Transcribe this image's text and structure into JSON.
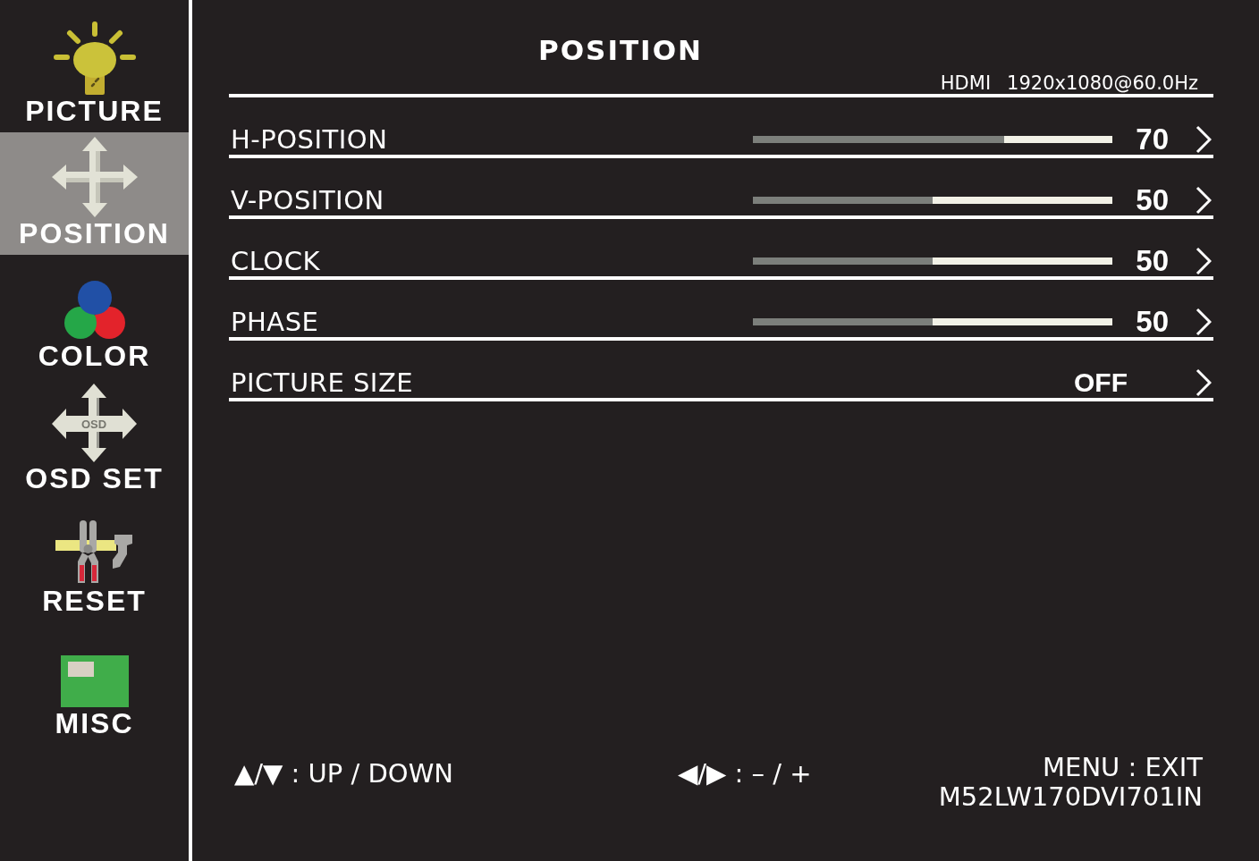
{
  "sidebar": {
    "items": [
      {
        "label": "PICTURE",
        "kind": "bulb",
        "selected": false
      },
      {
        "label": "POSITION",
        "kind": "arrows",
        "selected": true
      },
      {
        "label": "COLOR",
        "kind": "circles",
        "selected": false
      },
      {
        "label": "OSD SET",
        "kind": "osd_arrows",
        "icon_text": "OSD",
        "selected": false
      },
      {
        "label": "RESET",
        "kind": "tools",
        "selected": false
      },
      {
        "label": "MISC",
        "kind": "panel",
        "selected": false
      }
    ]
  },
  "panel": {
    "title": "POSITION",
    "input": "HDMI",
    "timing": "1920x1080@60.0Hz"
  },
  "settings": [
    {
      "label": "H-POSITION",
      "kind": "slider",
      "level": 0.7,
      "value": "70"
    },
    {
      "label": "V-POSITION",
      "kind": "slider",
      "level": 0.5,
      "value": "50"
    },
    {
      "label": "CLOCK",
      "kind": "slider",
      "level": 0.5,
      "value": "50"
    },
    {
      "label": "PHASE",
      "kind": "slider",
      "level": 0.5,
      "value": "50"
    },
    {
      "label": "PICTURE SIZE",
      "kind": "option",
      "value": "OFF"
    }
  ],
  "footer": {
    "hints": [
      "▲/▼ : UP / DOWN",
      "◀/▶ : – / +"
    ],
    "exit_hint": "MENU : EXIT",
    "model": "M52LW170DVI701IN"
  }
}
